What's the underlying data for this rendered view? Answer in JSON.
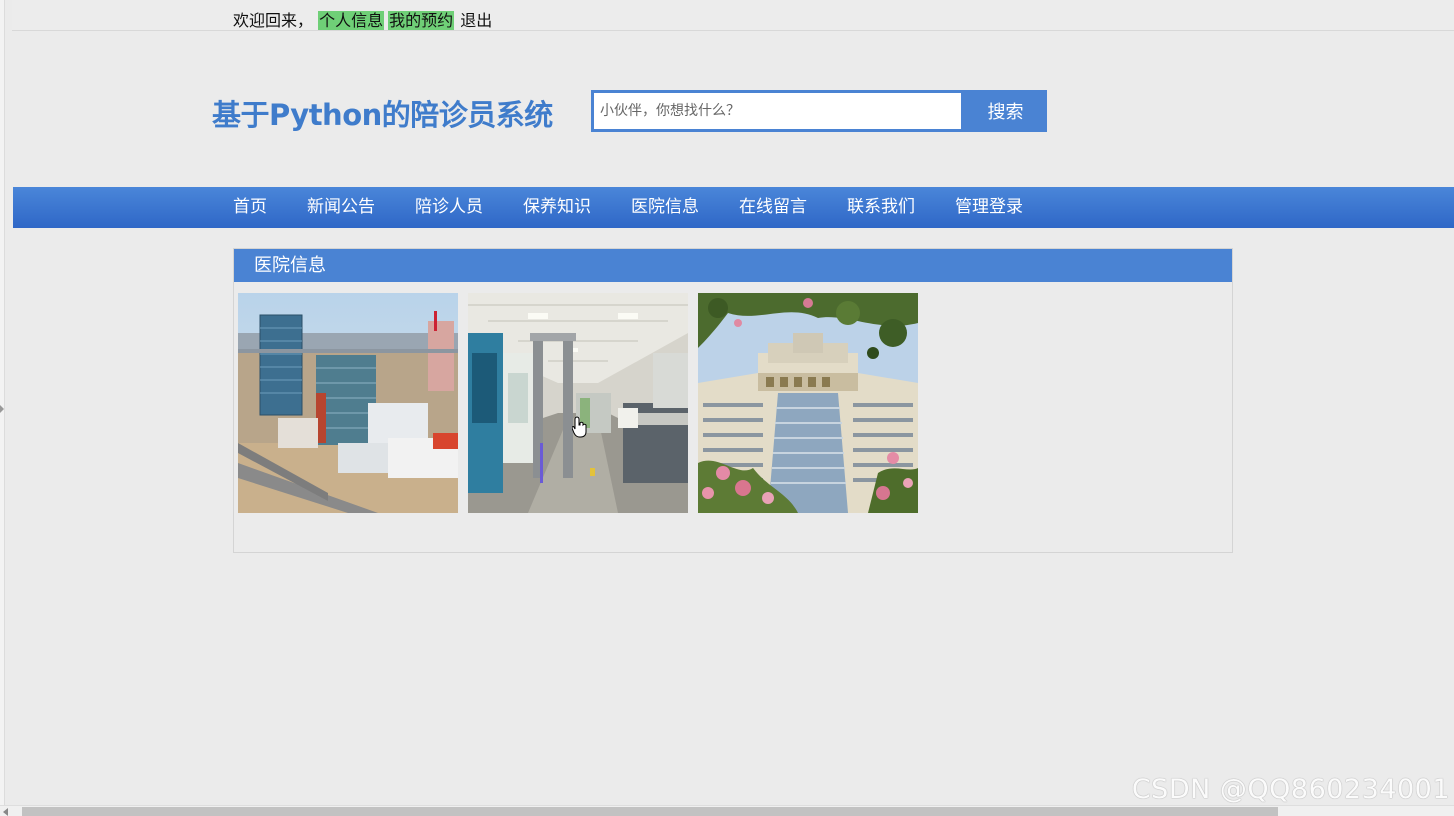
{
  "topbar": {
    "welcome": "欢迎回来，",
    "profile_link": "个人信息",
    "appointments_link": "我的预约",
    "logout_link": "退出"
  },
  "header": {
    "title": "基于Python的陪诊员系统"
  },
  "search": {
    "placeholder": "小伙伴，你想找什么？",
    "button_label": "搜索"
  },
  "nav": {
    "items": [
      {
        "label": "首页"
      },
      {
        "label": "新闻公告"
      },
      {
        "label": "陪诊人员"
      },
      {
        "label": "保养知识"
      },
      {
        "label": "医院信息"
      },
      {
        "label": "在线留言"
      },
      {
        "label": "联系我们"
      },
      {
        "label": "管理登录"
      }
    ]
  },
  "panel": {
    "title": "医院信息",
    "images": [
      {
        "name": "hospital-aerial-photo"
      },
      {
        "name": "hospital-lobby-photo"
      },
      {
        "name": "hospital-building-blossoms-photo"
      }
    ]
  },
  "colors": {
    "accent": "#4a83d3",
    "highlight": "#6fcf77",
    "background": "#ebebeb"
  },
  "watermark": "CSDN @QQ860234001"
}
